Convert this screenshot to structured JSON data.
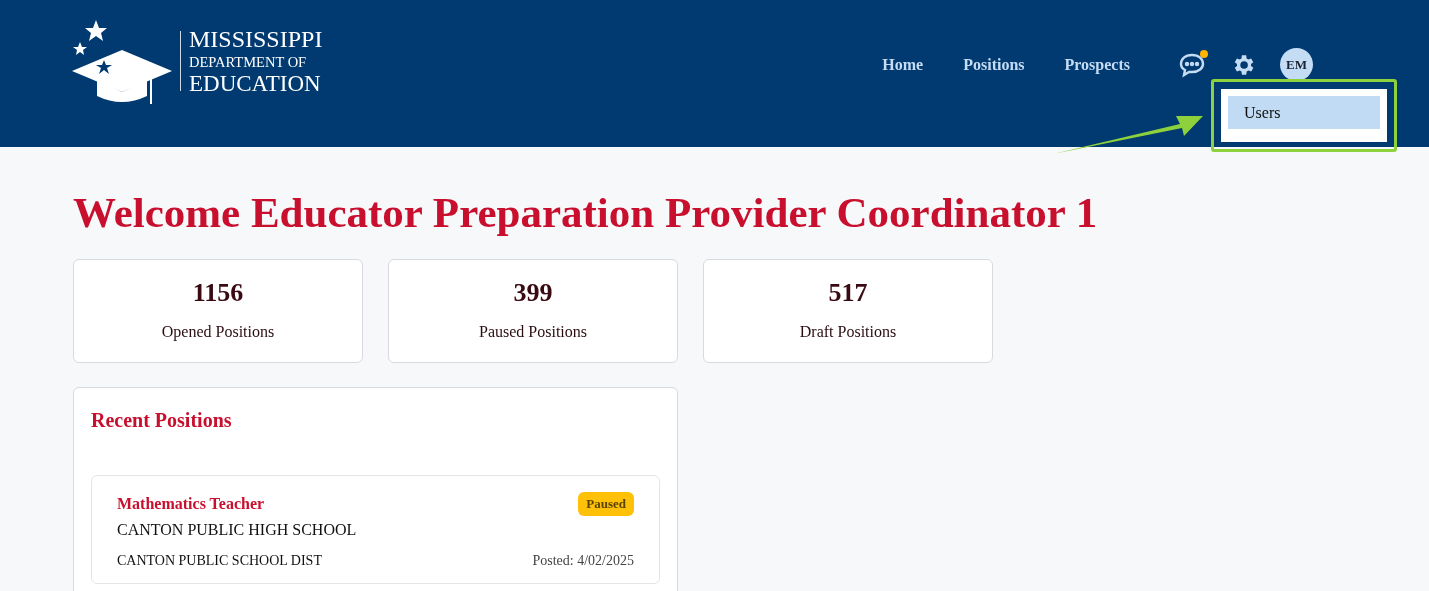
{
  "header": {
    "logo": {
      "line_1": "MISSISSIPPI",
      "line_2": "DEPARTMENT OF",
      "line_3": "EDUCATION"
    },
    "nav": [
      {
        "label": "Home"
      },
      {
        "label": "Positions"
      },
      {
        "label": "Prospects"
      }
    ],
    "messages": {
      "has_notification": true
    },
    "avatar": {
      "initials": "EM"
    },
    "settings_menu": {
      "open": true,
      "items": [
        {
          "label": "Users",
          "selected": true
        }
      ]
    }
  },
  "welcome": "Welcome Educator Preparation Provider Coordinator 1",
  "stats": [
    {
      "value": "1156",
      "label": "Opened Positions"
    },
    {
      "value": "399",
      "label": "Paused Positions"
    },
    {
      "value": "517",
      "label": "Draft Positions"
    }
  ],
  "recent": {
    "title": "Recent Positions",
    "items": [
      {
        "title": "Mathematics Teacher",
        "school": "CANTON PUBLIC HIGH SCHOOL",
        "district": "CANTON PUBLIC SCHOOL DIST",
        "posted": "Posted: 4/02/2025",
        "status": {
          "label": "Paused",
          "kind": "paused"
        }
      }
    ]
  }
}
